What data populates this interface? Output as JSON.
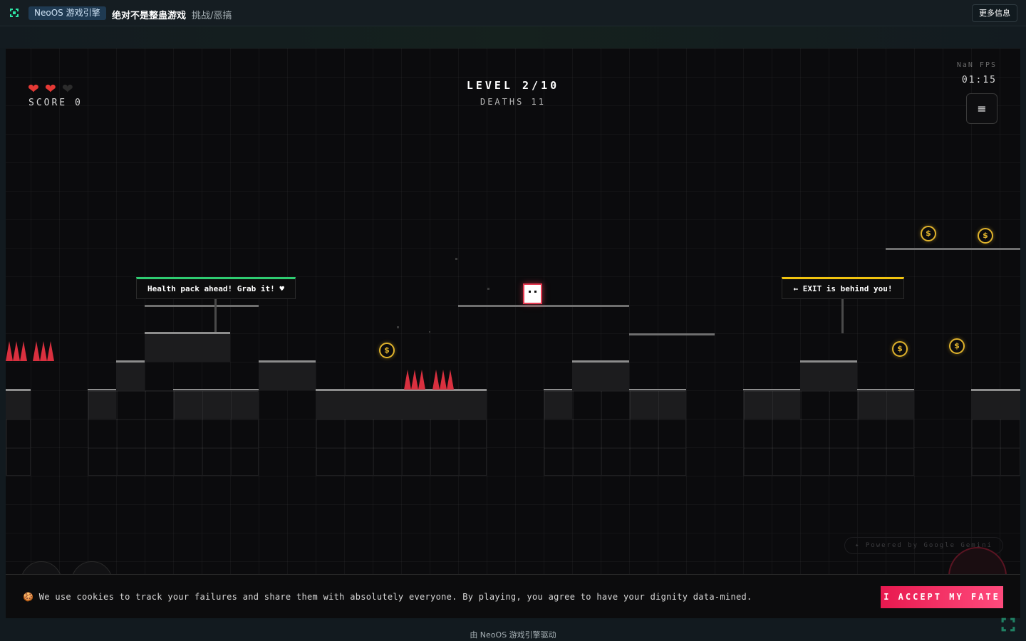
{
  "topbar": {
    "engine_badge": "NeoOS 游戏引擎",
    "game_title": "绝对不是整蛊游戏",
    "game_genre": "挑战/恶搞",
    "more_info": "更多信息"
  },
  "hud": {
    "hearts": [
      "full",
      "full",
      "empty"
    ],
    "score": "SCORE 0",
    "level": "LEVEL 2/10",
    "deaths": "DEATHS 11",
    "fps": "NaN FPS",
    "timer": "01:15",
    "menu_icon": "≡"
  },
  "signs": {
    "health": "Health pack ahead! Grab it! ♥",
    "exit": "← EXIT is behind you!"
  },
  "coin_symbol": "$",
  "powered_by": "✦ Powered by Google Gemini",
  "cookie": {
    "text": "🍪 We use cookies to track your failures and share them with absolutely everyone. By playing, you agree to have your dignity data-mined.",
    "accept_button": "I ACCEPT MY FATE"
  },
  "footer": {
    "text": "由 NeoOS 游戏引擎驱动"
  },
  "colors": {
    "accent_red": "#e8194f",
    "coin": "#e0b32c",
    "heart": "#e53935",
    "sign_green": "#2ecc71",
    "sign_yellow": "#f1c40f"
  }
}
